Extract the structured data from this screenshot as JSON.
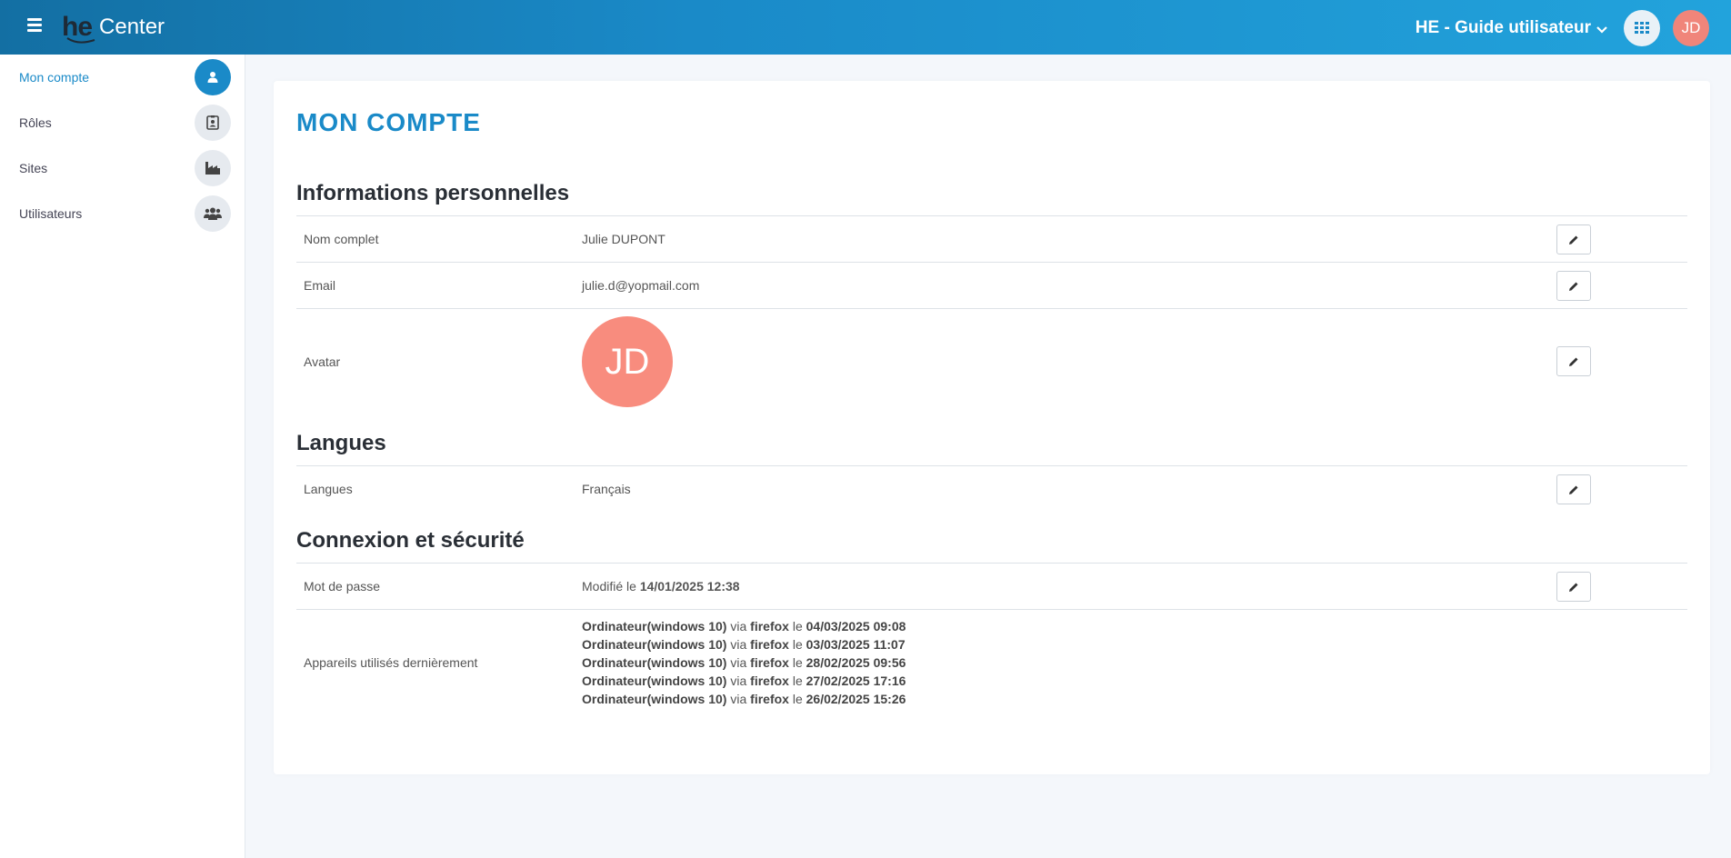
{
  "header": {
    "logo_he": "he",
    "logo_center": "Center",
    "guide_label": "HE - Guide utilisateur",
    "avatar_initials": "JD"
  },
  "sidebar": {
    "items": [
      {
        "label": "Mon compte",
        "icon": "user-icon",
        "active": true
      },
      {
        "label": "Rôles",
        "icon": "id-badge-icon",
        "active": false
      },
      {
        "label": "Sites",
        "icon": "factory-icon",
        "active": false
      },
      {
        "label": "Utilisateurs",
        "icon": "users-icon",
        "active": false
      }
    ]
  },
  "page": {
    "title": "MON COMPTE",
    "sections": {
      "personal": {
        "title": "Informations personnelles",
        "name_label": "Nom complet",
        "name_value": "Julie DUPONT",
        "email_label": "Email",
        "email_value": "julie.d@yopmail.com",
        "avatar_label": "Avatar",
        "avatar_initials": "JD"
      },
      "languages": {
        "title": "Langues",
        "label": "Langues",
        "value": "Français"
      },
      "security": {
        "title": "Connexion et sécurité",
        "password_label": "Mot de passe",
        "password_prefix": "Modifié le",
        "password_date": "14/01/2025 12:38",
        "devices_label": "Appareils utilisés dernièrement",
        "devices": [
          {
            "device": "Ordinateur(windows 10)",
            "via": "via",
            "browser": "firefox",
            "le": "le",
            "date": "04/03/2025 09:08"
          },
          {
            "device": "Ordinateur(windows 10)",
            "via": "via",
            "browser": "firefox",
            "le": "le",
            "date": "03/03/2025 11:07"
          },
          {
            "device": "Ordinateur(windows 10)",
            "via": "via",
            "browser": "firefox",
            "le": "le",
            "date": "28/02/2025 09:56"
          },
          {
            "device": "Ordinateur(windows 10)",
            "via": "via",
            "browser": "firefox",
            "le": "le",
            "date": "27/02/2025 17:16"
          },
          {
            "device": "Ordinateur(windows 10)",
            "via": "via",
            "browser": "firefox",
            "le": "le",
            "date": "26/02/2025 15:26"
          }
        ]
      }
    }
  },
  "colors": {
    "accent": "#1a8ac8",
    "avatar": "#f88c7e",
    "header_start": "#136fa3",
    "header_end": "#22a3dc"
  }
}
